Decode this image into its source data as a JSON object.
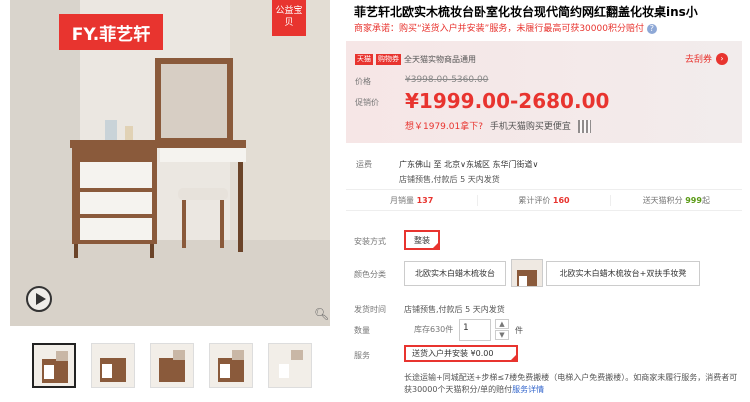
{
  "gallery": {
    "brand_logo": "FY.菲艺轩",
    "charity_badge": "公益宝贝",
    "thumbnails": [
      "thumb-1",
      "thumb-2",
      "thumb-3",
      "thumb-4",
      "thumb-5"
    ]
  },
  "product": {
    "title": "菲艺轩北欧实木梳妆台卧室化妆台现代简约网红翻盖化妆桌ins小",
    "promise": "商家承诺：购买“送货入户并安装”服务，未履行最高可获30000积分赔付"
  },
  "pricing": {
    "tag_tmall": "天猫",
    "tag_shopping": "购物券",
    "promo_text": "全天猫实物商品通用",
    "coupon_label": "去刮券",
    "price_label": "价格",
    "original_price": "¥3998.00-5360.00",
    "sale_label": "促销价",
    "sale_price": "¥1999.00-2680.00",
    "coupon_price": "想￥1979.01拿下?",
    "mobile_text": "手机天猫购买更便宜"
  },
  "shipping": {
    "label": "运费",
    "route": "广东佛山 至 北京∨东城区 东华门街道∨",
    "note": "店铺预售,付款后 5 天内发货"
  },
  "stats": {
    "monthly_label": "月销量",
    "monthly_value": "137",
    "review_label": "累计评价",
    "review_value": "160",
    "points_label": "送天猫积分",
    "points_value": "999",
    "points_suffix": "起"
  },
  "options": {
    "install_label": "安装方式",
    "install_value": "整装",
    "color_label": "颜色分类",
    "color_option_1": "北欧实木白蜡木梳妆台",
    "color_option_2": "北欧实木白蜡木梳妆台+双扶手妆凳",
    "send_label": "发货时间",
    "send_value": "店铺预售,付款后 5 天内发货",
    "qty_label": "数量",
    "qty_value": "1",
    "stock": "库存630件",
    "unit": "件",
    "service_label": "服务",
    "service_value": "送货入户并安装 ¥0.00",
    "service_desc": "长途运输+同城配送+步梯≤7楼免费搬楼（电梯入户免费搬楼）。如商家未履行服务，消费者可获30000个天猫积分/单的赔付",
    "service_link": "服务详情"
  }
}
